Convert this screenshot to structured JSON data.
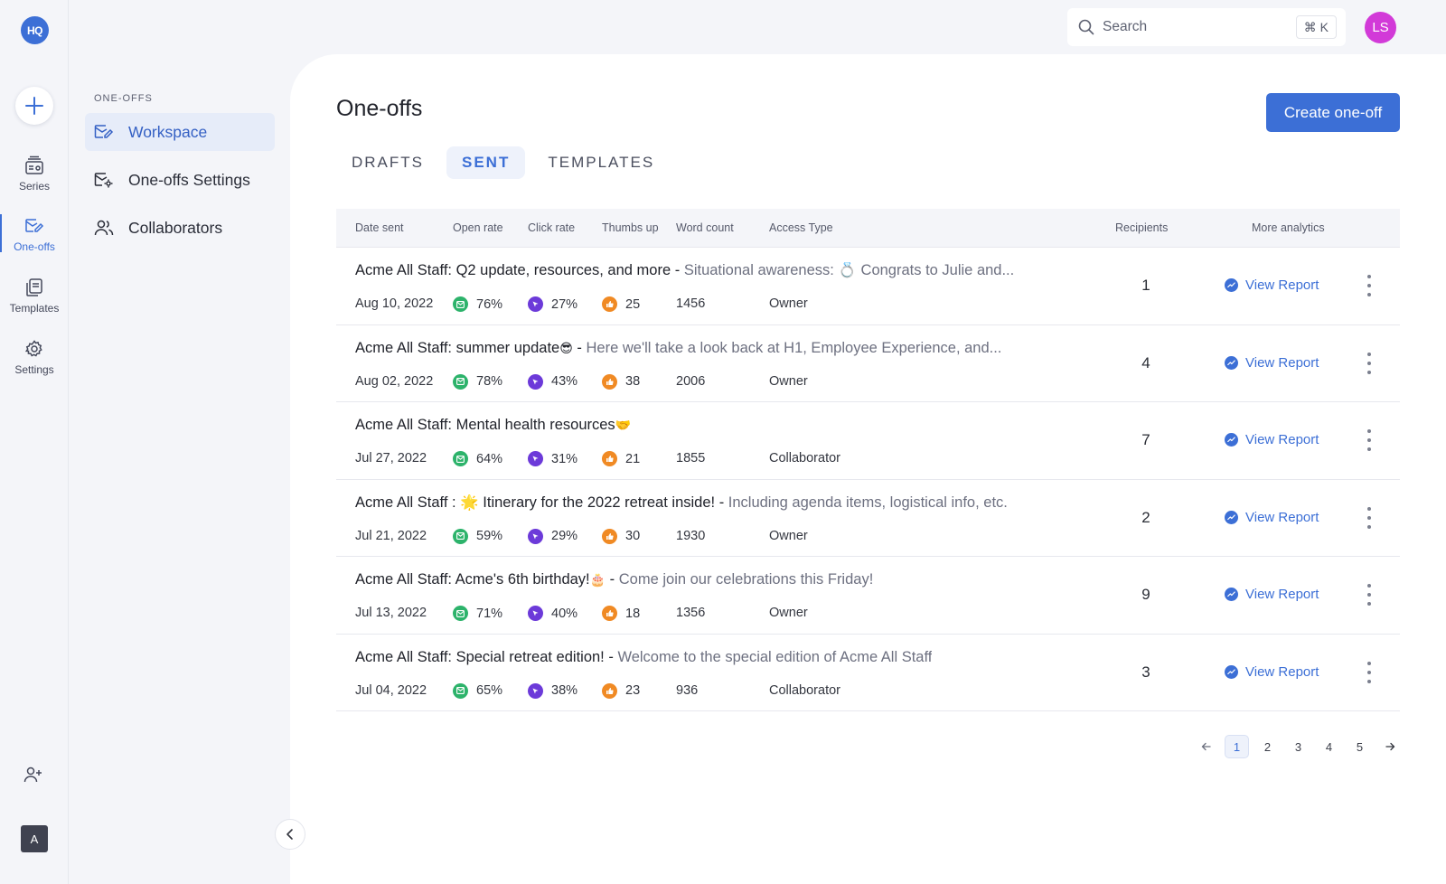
{
  "app": {
    "logo_text": "HQ"
  },
  "rail": {
    "items": [
      {
        "label": "Series",
        "icon": "series-icon"
      },
      {
        "label": "One-offs",
        "icon": "envelope-edit-icon",
        "active": true
      },
      {
        "label": "Templates",
        "icon": "templates-icon"
      },
      {
        "label": "Settings",
        "icon": "gear-icon"
      }
    ],
    "avatar_letter": "A"
  },
  "subnav": {
    "section_title": "ONE-OFFS",
    "items": [
      {
        "label": "Workspace",
        "active": true
      },
      {
        "label": "One-offs Settings"
      },
      {
        "label": "Collaborators"
      }
    ]
  },
  "topbar": {
    "search_placeholder": "Search",
    "shortcut": "⌘ K",
    "user_initials": "LS"
  },
  "page": {
    "title": "One-offs",
    "create_label": "Create one-off",
    "tabs": [
      {
        "label": "DRAFTS"
      },
      {
        "label": "SENT",
        "active": true
      },
      {
        "label": "TEMPLATES"
      }
    ]
  },
  "table": {
    "headers": {
      "date_sent": "Date sent",
      "open_rate": "Open rate",
      "click_rate": "Click rate",
      "thumbs_up": "Thumbs up",
      "word_count": "Word count",
      "access_type": "Access Type",
      "recipients": "Recipients",
      "more_analytics": "More analytics"
    },
    "view_report_label": "View Report",
    "rows": [
      {
        "head": "Acme All Staff: Q2 update, resources, and more",
        "emoji": "",
        "sep": " - ",
        "preview": "Situational awareness: 💍 Congrats to Julie and...",
        "date": "Aug 10, 2022",
        "open": "76%",
        "click": "27%",
        "thumbs": "25",
        "words": "1456",
        "access": "Owner",
        "recipients": "1"
      },
      {
        "head": "Acme All Staff:  summer update",
        "emoji": "😎",
        "sep": " - ",
        "preview": "Here we'll take a look back at H1, Employee Experience, and...",
        "date": "Aug 02, 2022",
        "open": "78%",
        "click": "43%",
        "thumbs": "38",
        "words": "2006",
        "access": "Owner",
        "recipients": "4"
      },
      {
        "head": "Acme All Staff: Mental health resources",
        "emoji": "🤝",
        "sep": "",
        "preview": "",
        "date": "Jul 27, 2022",
        "open": "64%",
        "click": "31%",
        "thumbs": "21",
        "words": "1855",
        "access": "Collaborator",
        "recipients": "7"
      },
      {
        "head": "Acme All Staff : 🌟 Itinerary for the 2022 retreat inside!",
        "emoji": "",
        "sep": " - ",
        "preview": "Including agenda items, logistical info, etc.",
        "date": "Jul 21, 2022",
        "open": "59%",
        "click": "29%",
        "thumbs": "30",
        "words": "1930",
        "access": "Owner",
        "recipients": "2"
      },
      {
        "head": "Acme All Staff: Acme's 6th birthday!",
        "emoji": "🎂",
        "sep": " - ",
        "preview": "Come join our celebrations this Friday!",
        "date": "Jul 13, 2022",
        "open": "71%",
        "click": "40%",
        "thumbs": "18",
        "words": "1356",
        "access": "Owner",
        "recipients": "9"
      },
      {
        "head": "Acme All Staff: Special retreat edition!",
        "emoji": "",
        "sep": " - ",
        "preview": "Welcome to the special edition of Acme All Staff",
        "date": "Jul 04, 2022",
        "open": "65%",
        "click": "38%",
        "thumbs": "23",
        "words": "936",
        "access": "Collaborator",
        "recipients": "3"
      }
    ]
  },
  "pagination": {
    "pages": [
      "1",
      "2",
      "3",
      "4",
      "5"
    ],
    "current": "1"
  },
  "colors": {
    "accent": "#3c6fd6",
    "open": "#2db36b",
    "click": "#6c3ad9",
    "thumbs": "#f08a24",
    "avatar": "#d23ad8"
  }
}
